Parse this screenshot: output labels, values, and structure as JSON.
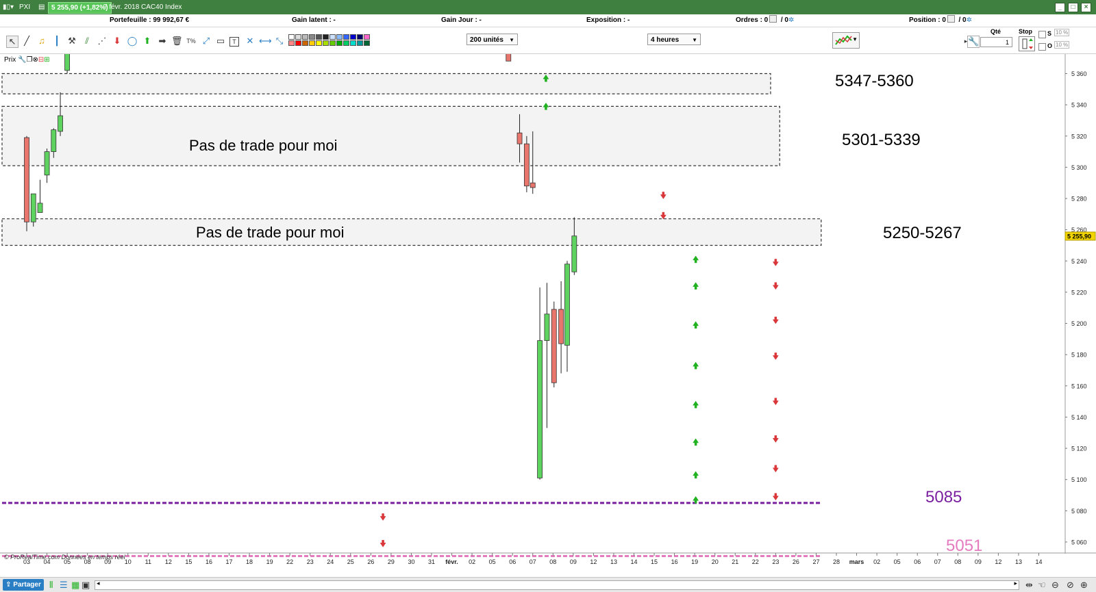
{
  "window": {
    "instrument": "PXI",
    "price_chip": "5 255,90 (+1,82%)",
    "title_text": "7 févr. 2018  CAC40 Index"
  },
  "account": {
    "portefeuille": "Portefeuille : 99 992,67 €",
    "gain_latent": "Gain latent : -",
    "gain_jour": "Gain Jour : -",
    "exposition": "Exposition : -",
    "ordres_a": "Ordres : 0",
    "ordres_b": "/ 0",
    "position_a": "Position : 0",
    "position_b": "/ 0"
  },
  "toolbar": {
    "units_select": "200 unités",
    "timeframe_select": "4 heures",
    "qty_label": "Qté",
    "qty_value": "1",
    "stop_label": "Stop",
    "s_label": "S",
    "o_label": "O",
    "pct_a": "10 %",
    "pct_b": "10 %"
  },
  "colors": {
    "up": "#5fd35f",
    "down": "#e8766d",
    "zone_fill": "#f3f3f3",
    "level_5085": "#7a1fa0",
    "level_5051": "#e57bbf",
    "arrow_up": "#1fb11f",
    "arrow_down": "#d9373a",
    "title_bar": "#3f7f3f"
  },
  "chart": {
    "prix_label": "Prix",
    "copyright": "© ProRealTime.com  Données en temps réel",
    "zones": [
      {
        "label": "5347-5360",
        "text": ""
      },
      {
        "label": "5301-5339",
        "text": "Pas de trade pour moi"
      },
      {
        "label": "5250-5267",
        "text": "Pas de trade pour moi"
      }
    ],
    "levels": [
      {
        "label": "5085",
        "value": 5085
      },
      {
        "label": "5051",
        "value": 5051
      }
    ],
    "price_tag": "5 255,90"
  },
  "chart_data": {
    "type": "candlestick",
    "y_ticks": [
      "5 060",
      "5 080",
      "5 100",
      "5 120",
      "5 140",
      "5 160",
      "5 180",
      "5 200",
      "5 220",
      "5 240",
      "5 260",
      "5 280",
      "5 300",
      "5 320",
      "5 340",
      "5 360"
    ],
    "ylim": [
      5046,
      5370
    ],
    "x_ticks": [
      "03",
      "04",
      "05",
      "08",
      "09",
      "10",
      "11",
      "12",
      "15",
      "16",
      "17",
      "18",
      "19",
      "22",
      "23",
      "24",
      "25",
      "26",
      "29",
      "30",
      "31",
      "févr.",
      "02",
      "05",
      "06",
      "07",
      "08",
      "09",
      "12",
      "13",
      "14",
      "15",
      "16",
      "19",
      "20",
      "21",
      "22",
      "23",
      "26",
      "27",
      "28",
      "mars",
      "02",
      "05",
      "06",
      "07",
      "08",
      "09",
      "12",
      "13",
      "14"
    ],
    "candles": [
      {
        "slot": 0.0,
        "o": 5319,
        "h": 5320,
        "l": 5259,
        "c": 5265
      },
      {
        "slot": 0.33,
        "o": 5265,
        "h": 5283,
        "l": 5262,
        "c": 5283
      },
      {
        "slot": 0.66,
        "o": 5271,
        "h": 5292,
        "l": 5275,
        "c": 5277
      },
      {
        "slot": 1.0,
        "o": 5295,
        "h": 5312,
        "l": 5290,
        "c": 5310
      },
      {
        "slot": 1.33,
        "o": 5310,
        "h": 5325,
        "l": 5306,
        "c": 5324
      },
      {
        "slot": 1.66,
        "o": 5323,
        "h": 5348,
        "l": 5320,
        "c": 5333
      },
      {
        "slot": 2.0,
        "o": 5362,
        "h": 5376,
        "l": 5360,
        "c": 5376
      },
      {
        "slot": 23.8,
        "o": 5376,
        "h": 5380,
        "l": 5368,
        "c": 5368
      },
      {
        "slot": 24.35,
        "o": 5322,
        "h": 5334,
        "l": 5303,
        "c": 5315
      },
      {
        "slot": 24.7,
        "o": 5315,
        "h": 5320,
        "l": 5284,
        "c": 5288
      },
      {
        "slot": 25.0,
        "o": 5290,
        "h": 5323,
        "l": 5283,
        "c": 5287
      },
      {
        "slot": 25.35,
        "o": 5101,
        "h": 5223,
        "l": 5100,
        "c": 5189
      },
      {
        "slot": 25.7,
        "o": 5189,
        "h": 5226,
        "l": 5133,
        "c": 5206
      },
      {
        "slot": 26.05,
        "o": 5209,
        "h": 5214,
        "l": 5159,
        "c": 5162
      },
      {
        "slot": 26.4,
        "o": 5209,
        "h": 5227,
        "l": 5168,
        "c": 5187
      },
      {
        "slot": 26.7,
        "o": 5186,
        "h": 5240,
        "l": 5169,
        "c": 5238
      },
      {
        "slot": 27.05,
        "o": 5233,
        "h": 5268,
        "l": 5231,
        "c": 5256
      }
    ],
    "up_arrows": [
      {
        "slot": 25.65,
        "y": [
          5357,
          5339
        ]
      },
      {
        "slot": 33.05,
        "y": [
          5241,
          5224,
          5199,
          5173,
          5148,
          5124,
          5103,
          5087
        ]
      }
    ],
    "down_arrows": [
      {
        "slot": 17.6,
        "y": [
          5076,
          5059
        ]
      },
      {
        "slot": 31.45,
        "y": [
          5282,
          5269
        ]
      },
      {
        "slot": 37.0,
        "y": [
          5239,
          5224,
          5202,
          5179,
          5150,
          5126,
          5107,
          5089
        ]
      }
    ],
    "zones": [
      {
        "low": 5347,
        "high": 5360,
        "x_end_slot": 36.75
      },
      {
        "low": 5301,
        "high": 5339,
        "x_end_slot": 37.2
      },
      {
        "low": 5250,
        "high": 5267,
        "x_end_slot": 39.25
      }
    ],
    "horizontal_levels": [
      5085,
      5051
    ],
    "last_price": 5255.9
  }
}
